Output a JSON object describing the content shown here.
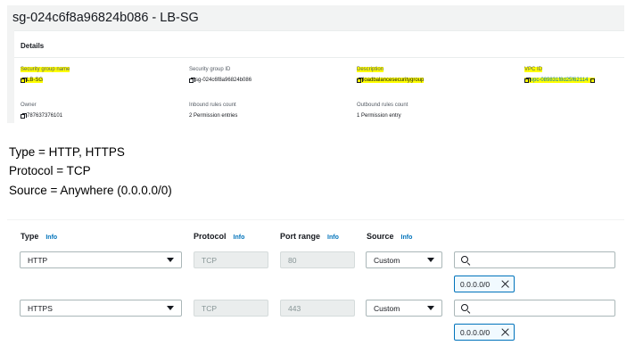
{
  "security_group": {
    "title": "sg-024c6f8a96824b086 - LB-SG",
    "details_heading": "Details",
    "fields": {
      "name": {
        "label": "Security group name",
        "value": "LB-SG"
      },
      "id": {
        "label": "Security group ID",
        "value": "sg-024c6f8a96824b086"
      },
      "description": {
        "label": "Description",
        "value": "loadbalancesecuritygroup"
      },
      "vpc": {
        "label": "VPC ID",
        "value": "vpc-089831f8d25f62114"
      },
      "owner": {
        "label": "Owner",
        "value": "787637376101"
      },
      "inbound": {
        "label": "Inbound rules count",
        "value": "2 Permission entries"
      },
      "outbound": {
        "label": "Outbound rules count",
        "value": "1 Permission entry"
      }
    },
    "highlight_color": "#ffff00"
  },
  "notes": {
    "type": "Type  = HTTP, HTTPS",
    "protocol": "Protocol = TCP",
    "source": "Source = Anywhere (0.0.0.0/0)"
  },
  "rules_editor": {
    "headers": {
      "type": "Type",
      "protocol": "Protocol",
      "port_range": "Port range",
      "source": "Source",
      "info": "Info"
    },
    "rules": [
      {
        "type": "HTTP",
        "protocol": "TCP",
        "port_range": "80",
        "source": "Custom",
        "search_value": "",
        "cidr": "0.0.0.0/0"
      },
      {
        "type": "HTTPS",
        "protocol": "TCP",
        "port_range": "443",
        "source": "Custom",
        "search_value": "",
        "cidr": "0.0.0.0/0"
      }
    ],
    "icons": {
      "dropdown": "caret-down-icon",
      "search": "search-icon",
      "remove": "close-icon",
      "copy": "copy-icon",
      "external": "external-link-icon"
    }
  }
}
